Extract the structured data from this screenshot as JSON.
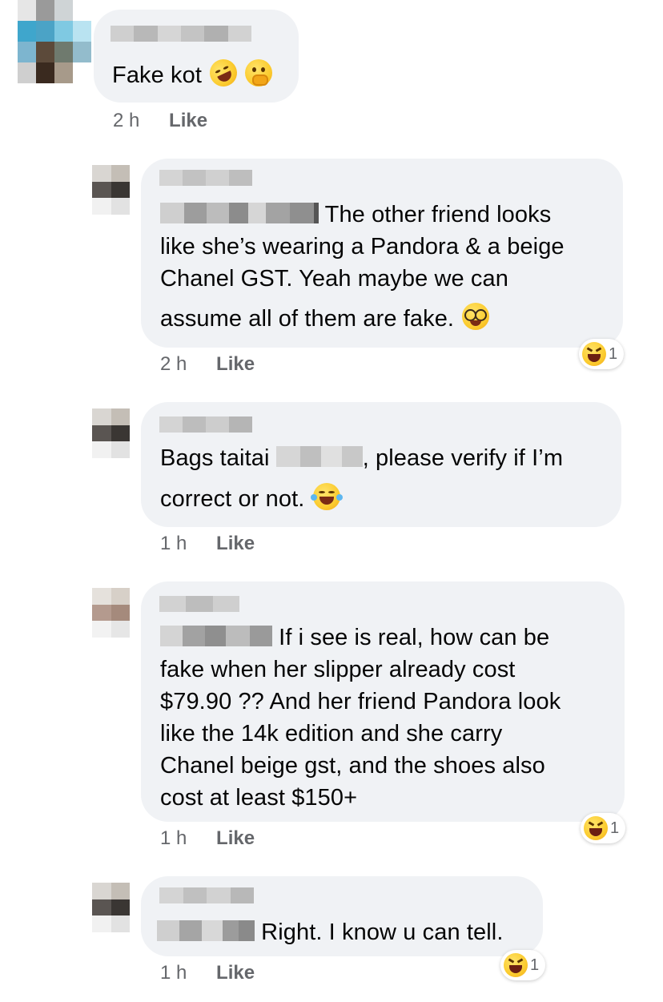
{
  "colors": {
    "bubble_bg": "#f0f2f5",
    "meta_text": "#65676b",
    "body_text": "#050505"
  },
  "comments": [
    {
      "text": "Fake kot",
      "emojis": [
        "rolling-on-floor-laughing-emoji",
        "hand-over-mouth-emoji"
      ],
      "time": "2 h",
      "like_label": "Like"
    },
    {
      "text": "The other friend looks",
      "lines": [
        "like she’s wearing a Pandora & a beige",
        "Chanel GST. Yeah maybe we can",
        "assume all of them are fake."
      ],
      "emojis": [
        "nerd-face-emoji"
      ],
      "time": "2 h",
      "like_label": "Like",
      "reaction": {
        "icon": "laughing-squint-emoji",
        "count": "1"
      }
    },
    {
      "text_before": "Bags taitai",
      "text_after": ", please verify if I’m",
      "lines": [
        "correct or not."
      ],
      "emojis": [
        "tears-of-joy-emoji"
      ],
      "time": "1 h",
      "like_label": "Like"
    },
    {
      "text": "If i see is real, how can be",
      "lines": [
        "fake when her slipper already cost",
        "$79.90 ?? And her friend Pandora look",
        "like the 14k edition and she carry",
        "Chanel beige gst, and the shoes also",
        "cost at least $150+"
      ],
      "time": "1 h",
      "like_label": "Like",
      "reaction": {
        "icon": "laughing-squint-emoji",
        "count": "1"
      }
    },
    {
      "text": "Right. I know u can tell.",
      "time": "1 h",
      "like_label": "Like",
      "reaction": {
        "icon": "laughing-squint-emoji",
        "count": "1"
      }
    }
  ]
}
